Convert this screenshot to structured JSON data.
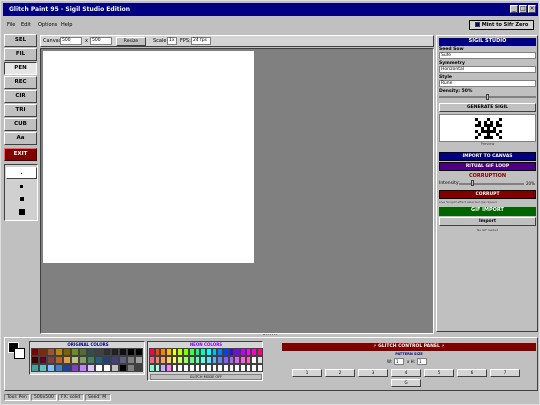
{
  "window": {
    "title": "Glitch Paint 95 - Sigil Studio Edition",
    "controls": [
      "_",
      "□",
      "×"
    ]
  },
  "menu": {
    "file": "File",
    "edit": "Edit",
    "options": "Options",
    "help": "Help"
  },
  "theme_button": "Mint to Sifr Zero",
  "tools": [
    "SEL",
    "FIL",
    "PEN",
    "REC",
    "CIR",
    "TRI",
    "CUB",
    "Aa",
    "EXIT"
  ],
  "active_tool": "PEN",
  "canvas_bar": {
    "canvas_label": "Canvas:",
    "width": "500",
    "x": "x",
    "height": "500",
    "resize": "Resize",
    "scale_label": "Scale:",
    "scale": "1x",
    "fps_label": "FPS:",
    "fps": "24 fps"
  },
  "sigil": {
    "header": "SIGIL STUDIO",
    "seed_label": "Seed Sow",
    "seed_value": "Sufe",
    "symmetry_label": "Symmetry",
    "symmetry_value": "Horizontal",
    "style_label": "Style",
    "style_value": "Rune",
    "density_label": "Density: 50%",
    "density": 0.5,
    "generate": "GENERATE SIGIL",
    "preview_caption": "Preview",
    "import_canvas": "IMPORT TO CANVAS",
    "ritual_loop": "RITUAL GIF LOOP",
    "corruption_title": "CORRUPTION",
    "intensity_label": "Intensity:",
    "intensity_value": "20%",
    "intensity": 0.2,
    "corrupt": "CORRUPT",
    "corrupt_note": "Live Sorgild effect selected (ps) Speed",
    "gif_import": "GIF IMPORT",
    "import": "Import",
    "no_gif": "No GIF loaded"
  },
  "palette": {
    "original_title": "ORIGINAL COLORS",
    "neon_title": "NEON COLORS",
    "glitch_mode": "GLITCH MODE OFF",
    "original_colors": [
      "#800000",
      "#8b2500",
      "#a0522d",
      "#b8860b",
      "#806000",
      "#6b8e23",
      "#556b2f",
      "#2f4f4f",
      "#404040",
      "#303030",
      "#202020",
      "#101010",
      "#000000",
      "#000000",
      "#400000",
      "#600020",
      "#804040",
      "#c06020",
      "#e0a040",
      "#c0c080",
      "#80a060",
      "#408060",
      "#206080",
      "#204080",
      "#404080",
      "#606080",
      "#808080",
      "#a0a0a0",
      "#40a0a0",
      "#60c0c0",
      "#80c0ff",
      "#4080c0",
      "#2040a0",
      "#8040c0",
      "#c080ff",
      "#e0c0ff",
      "#ffffff",
      "#ffffff",
      "#c0c0c0",
      "#000000",
      "#808080",
      "#404040"
    ],
    "neon_colors": [
      "#ff0040",
      "#ff4000",
      "#ff8000",
      "#ffbf00",
      "#ffff00",
      "#bfff00",
      "#80ff00",
      "#40ff40",
      "#00ff80",
      "#00ffbf",
      "#00ffff",
      "#00bfff",
      "#0080ff",
      "#0040ff",
      "#4000ff",
      "#8000ff",
      "#bf00ff",
      "#ff00ff",
      "#ff00bf",
      "#ff0080",
      "#ff6080",
      "#ff8060",
      "#ffa060",
      "#ffd060",
      "#ffff60",
      "#d0ff60",
      "#a0ff60",
      "#60ff80",
      "#60ffb0",
      "#60ffe0",
      "#60e0ff",
      "#60b0ff",
      "#6080ff",
      "#8060ff",
      "#b060ff",
      "#e060ff",
      "#ff60e0",
      "#ff60b0",
      "#ffffff",
      "#e0e0e0",
      "#80ffd0",
      "#a0ffe0",
      "#c0b0ff",
      "#ff80ff",
      "#ffffff",
      "#ffffff",
      "#ffffff",
      "#ffffff",
      "#ffffff",
      "#ffffff",
      "#ffffff",
      "#ffffff",
      "#ffffff",
      "#ffffff",
      "#ffffff",
      "#ffffff",
      "#ffffff",
      "#ffffff",
      "#ffffff",
      "#ffffff"
    ]
  },
  "glitch_panel": {
    "title": "⚡ GLITCH CONTROL PANEL ⚡",
    "pattern_size": "PATTERN SIZE",
    "w_label": "W:",
    "w_value": "1",
    "x_label": "x H:",
    "h_value": "1",
    "buttons": [
      "1",
      "2",
      "3",
      "4",
      "5",
      "6",
      "7",
      "8"
    ],
    "last": "G"
  },
  "status": {
    "tool": "Tool: Pen",
    "size": "500x500",
    "fx": "FX: solid",
    "seed": "Seed: M"
  },
  "colors": {
    "titlebar": "#000080",
    "exit": "#800000",
    "sigil_header": "#000080",
    "import_btn": "#000080",
    "ritual_btn": "#4b0082",
    "corrupt_btn": "#800000",
    "gif_header": "#006400",
    "glitch_header": "#800000"
  }
}
